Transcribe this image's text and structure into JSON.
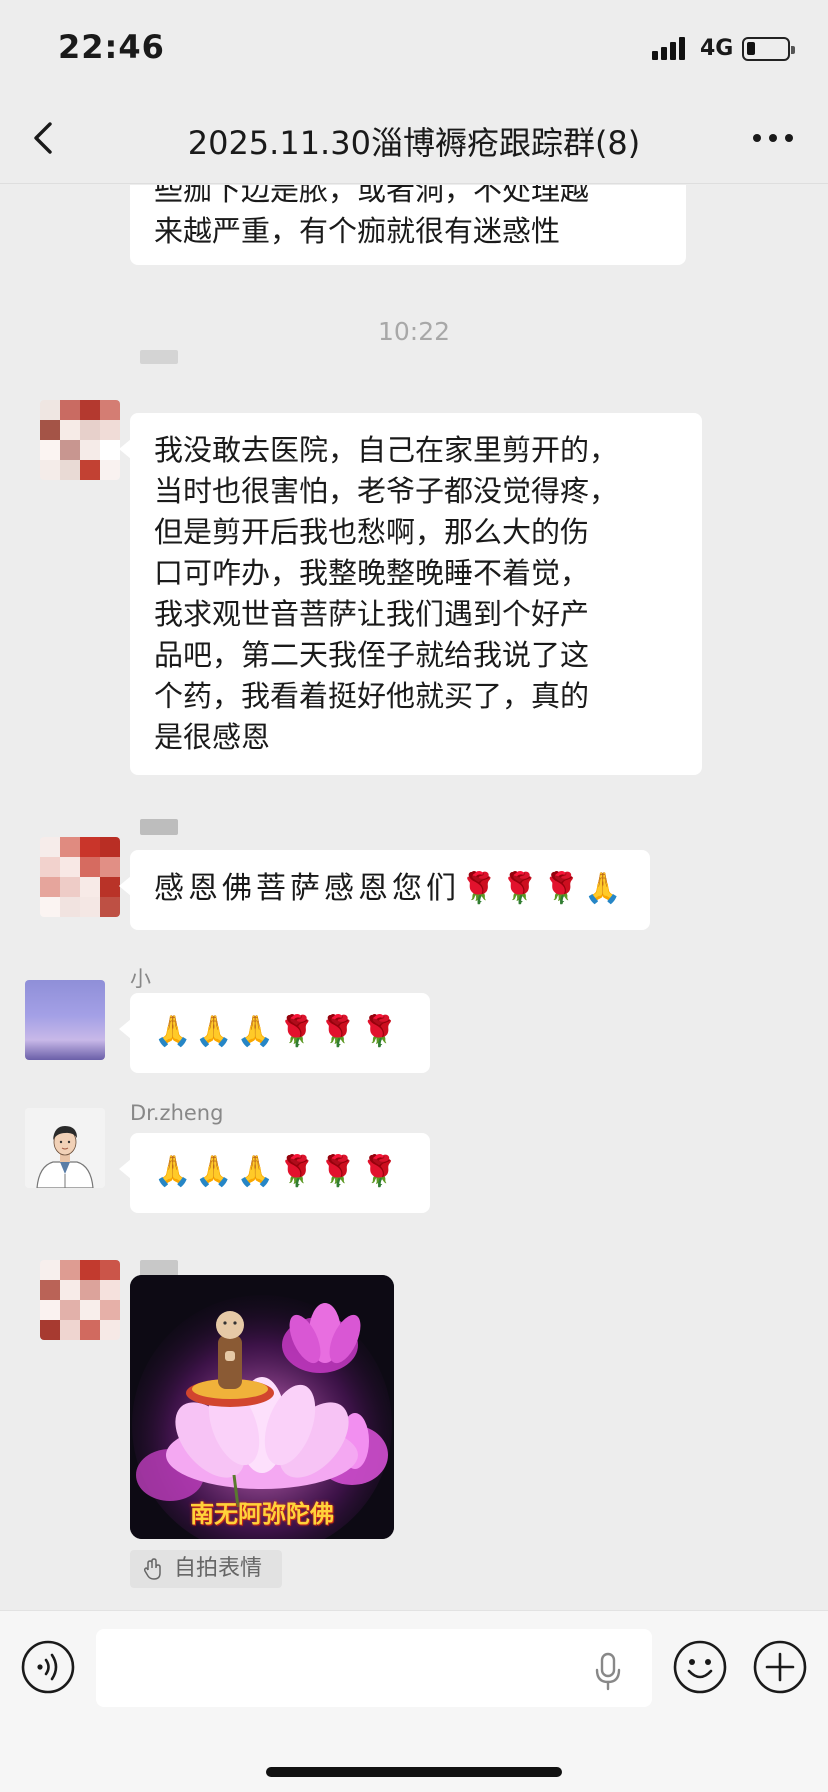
{
  "status_bar": {
    "time": "22:46",
    "network": "4G",
    "signal_icon": "signal-bars-icon",
    "battery_icon": "battery-icon",
    "battery_level": 0.2
  },
  "nav": {
    "title": "2025.11.30淄博褥疮跟踪群(8)",
    "back_icon": "chevron-left-icon",
    "more_icon": "more-dots-icon"
  },
  "messages": [
    {
      "type": "text",
      "lines": [
        "些痂下边是脓，或者洞，不处理越",
        "来越严重，有个痂就很有迷惑性"
      ]
    },
    {
      "type": "time",
      "text": "10:22"
    },
    {
      "type": "text",
      "lines": [
        "我没敢去医院，自己在家里剪开的，",
        "当时也很害怕，老爷子都没觉得疼，",
        "但是剪开后我也愁啊，那么大的伤",
        "口可咋办，我整晚整晚睡不着觉，",
        "我求观世音菩萨让我们遇到个好产",
        "品吧，第二天我侄子就给我说了这",
        "个药，我看着挺好他就买了，真的",
        "是很感恩"
      ]
    },
    {
      "type": "text",
      "text": "感恩佛菩萨感恩您们🌹🌹🌹🙏"
    },
    {
      "type": "text",
      "sender": "小",
      "text": "🙏🙏🙏🌹🌹🌹"
    },
    {
      "type": "text",
      "sender": "Dr.zheng",
      "text": "🙏🙏🙏🌹🌹🌹"
    },
    {
      "type": "sticker",
      "caption": "南无阿弥陀佛"
    }
  ],
  "selfie_chip": {
    "label": "自拍表情",
    "icon": "hand-wave-icon"
  },
  "input_bar": {
    "voice_icon": "voice-mode-icon",
    "mic_icon": "microphone-icon",
    "emoji_icon": "smiley-icon",
    "plus_icon": "plus-circle-icon"
  },
  "colors": {
    "background": "#ededed",
    "bubble": "#ffffff",
    "timestamp": "#a8a8a8",
    "sticker_text": "#ffd23a"
  }
}
